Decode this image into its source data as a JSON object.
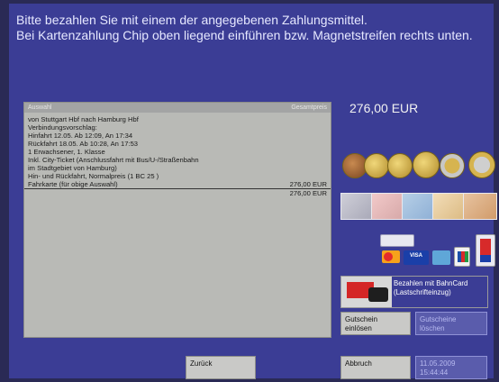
{
  "instructions": {
    "line1": "Bitte bezahlen Sie mit einem der angegebenen Zahlungsmittel.",
    "line2": "Bei Kartenzahlung Chip oben liegend einführen bzw. Magnetstreifen rechts unten."
  },
  "selection": {
    "header_left": "Auswahl",
    "header_right": "Gesamtpreis",
    "lines": [
      "von Stuttgart Hbf nach Hamburg Hbf",
      "Verbindungsvorschlag:",
      "Hinfahrt 12.05. Ab 12:09, An 17:34",
      "Rückfahrt 18.05. Ab 10:28, An 17:53",
      "1 Erwachsener, 1. Klasse",
      "Inkl. City-Ticket (Anschlussfahrt mit Bus/U-/Straßenbahn",
      "im Stadtgebiet von Hamburg)",
      "Hin- und Rückfahrt, Normalpreis (1 BC 25  )"
    ],
    "fare_label": "Fahrkarte (für obige Auswahl)",
    "fare_price": "276,00 EUR",
    "total_price": "276,00 EUR"
  },
  "payment": {
    "amount": "276,00 EUR",
    "coin_icons": [
      "coin-1-cent-icon",
      "coin-10-cent-icon",
      "coin-20-cent-icon",
      "coin-50-cent-icon",
      "coin-1-euro-icon",
      "coin-2-euro-icon"
    ],
    "note_icons": [
      "banknote-5-icon",
      "banknote-10-icon",
      "banknote-20-icon",
      "banknote-50-icon",
      "banknote-100-icon"
    ],
    "card_icons": [
      "girocard-icon",
      "mastercard-icon",
      "visa-icon",
      "amex-icon",
      "jcb-icon",
      "ec-icon"
    ],
    "bahncard_label": "Bezahlen mit BahnCard",
    "bahncard_sub": "(Lastschrifteinzug)"
  },
  "buttons": {
    "gutschein_einloesen_1": "Gutschein",
    "gutschein_einloesen_2": "einlösen",
    "gutscheine_loeschen_1": "Gutscheine",
    "gutscheine_loeschen_2": "löschen",
    "zurueck": "Zurück",
    "abbruch": "Abbruch"
  },
  "status": {
    "date": "11.05.2009",
    "time": "15:44:44"
  },
  "colors": {
    "background": "#3b3d95",
    "panel": "#b9bab6",
    "button_light": "#c9c9c7"
  }
}
